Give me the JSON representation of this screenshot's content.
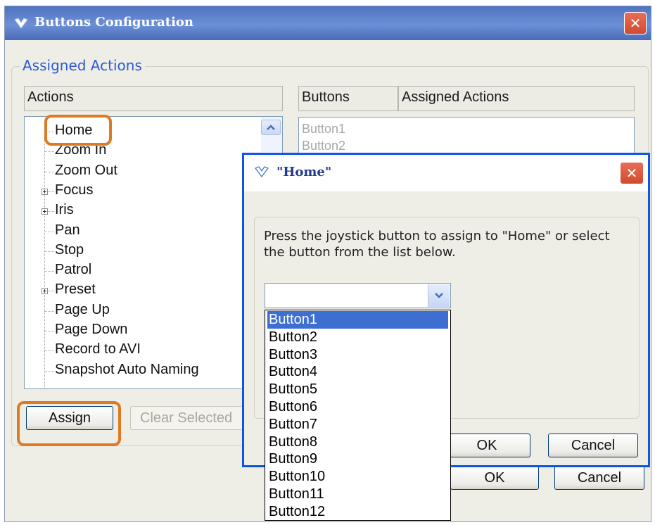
{
  "main_window": {
    "title": "Buttons Configuration",
    "group_title": "Assigned Actions",
    "actions_header": "Actions",
    "buttons_header": "Buttons",
    "assigned_header": "Assigned Actions",
    "tree": [
      {
        "label": "Home",
        "expandable": false
      },
      {
        "label": "Zoom In",
        "expandable": false
      },
      {
        "label": "Zoom Out",
        "expandable": false
      },
      {
        "label": "Focus",
        "expandable": true
      },
      {
        "label": "Iris",
        "expandable": true
      },
      {
        "label": "Pan",
        "expandable": false
      },
      {
        "label": "Stop",
        "expandable": false
      },
      {
        "label": "Patrol",
        "expandable": false
      },
      {
        "label": "Preset",
        "expandable": true
      },
      {
        "label": "Page Up",
        "expandable": false
      },
      {
        "label": "Page Down",
        "expandable": false
      },
      {
        "label": "Record to AVI",
        "expandable": false
      },
      {
        "label": "Snapshot Auto Naming",
        "expandable": false
      }
    ],
    "buttons_list": [
      "Button1",
      "Button2"
    ],
    "assign_label": "Assign",
    "clear_selected_label": "Clear Selected",
    "ok_label": "OK",
    "cancel_label": "Cancel",
    "close_glyph": "✕"
  },
  "dialog": {
    "title": "\"Home\"",
    "message": "Press the joystick button to assign to \"Home\" or select the button from the list below.",
    "combo_value": "",
    "options": [
      "Button1",
      "Button2",
      "Button3",
      "Button4",
      "Button5",
      "Button6",
      "Button7",
      "Button8",
      "Button9",
      "Button10",
      "Button11",
      "Button12"
    ],
    "selected_option": "Button1",
    "ok_label": "OK",
    "cancel_label": "Cancel",
    "close_glyph": "✕"
  },
  "colors": {
    "title_bar": "#5b7fcf",
    "dialog_border": "#0d55e6",
    "highlight": "#e07a22",
    "selection": "#3d6fd3",
    "group_title": "#2b5bd5"
  }
}
